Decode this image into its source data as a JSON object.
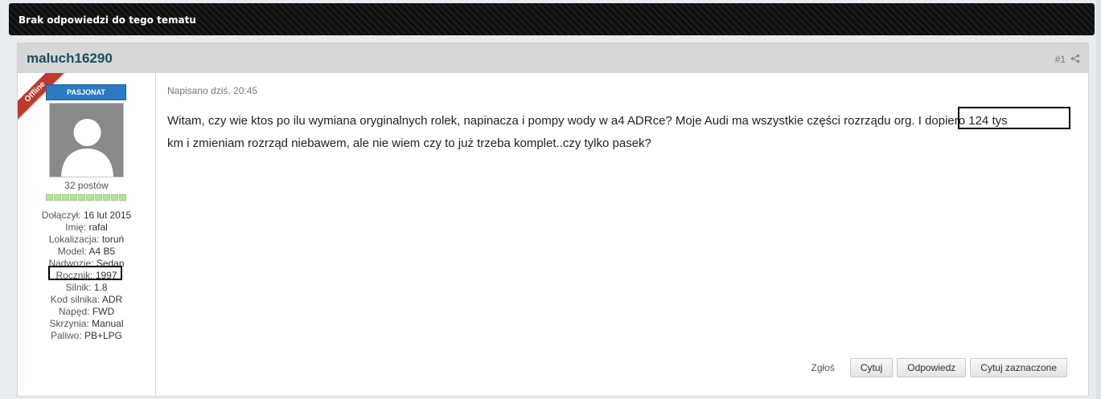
{
  "topbar": {
    "title": "Brak odpowiedzi do tego tematu"
  },
  "post": {
    "author": "maluch16290",
    "number": "#1",
    "status_ribbon": "Offline",
    "rank": "PASJONAT",
    "posts": "32 postów",
    "reputation_segments": 10,
    "profile": [
      {
        "label": "Dołączył:",
        "value": "16 lut 2015"
      },
      {
        "label": "Imię:",
        "value": "rafal"
      },
      {
        "label": "Lokalizacja:",
        "value": "toruń"
      },
      {
        "label": "Model:",
        "value": "A4 B5"
      },
      {
        "label": "Nadwozie:",
        "value": "Sedan"
      },
      {
        "label": "Rocznik:",
        "value": "1997"
      },
      {
        "label": "Silnik:",
        "value": "1.8"
      },
      {
        "label": "Kod silnika:",
        "value": "ADR"
      },
      {
        "label": "Napęd:",
        "value": "FWD"
      },
      {
        "label": "Skrzynia:",
        "value": "Manual"
      },
      {
        "label": "Paliwo:",
        "value": "PB+LPG"
      }
    ],
    "date": "Napisano dziś, 20:45",
    "body_line1": "Witam, czy wie ktos po ilu wymiana oryginalnych rolek, napinacza i pompy wody w a4 ADRce? Moje Audi ma wszystkie części rozrządu org. I dopiero 124 tys",
    "body_line2": "km i zmieniam rozrząd niebawem, ale nie wiem czy to już trzeba komplet..czy tylko pasek?",
    "actions": {
      "report": "Zgłoś",
      "quote": "Cytuj",
      "reply": "Odpowiedz",
      "quote_selected": "Cytuj zaznaczone"
    }
  },
  "colors": {
    "author": "#184f61",
    "rank_bg": "#2a7bc4",
    "ribbon": "#c0392b",
    "reputation": "#b6e29d"
  }
}
